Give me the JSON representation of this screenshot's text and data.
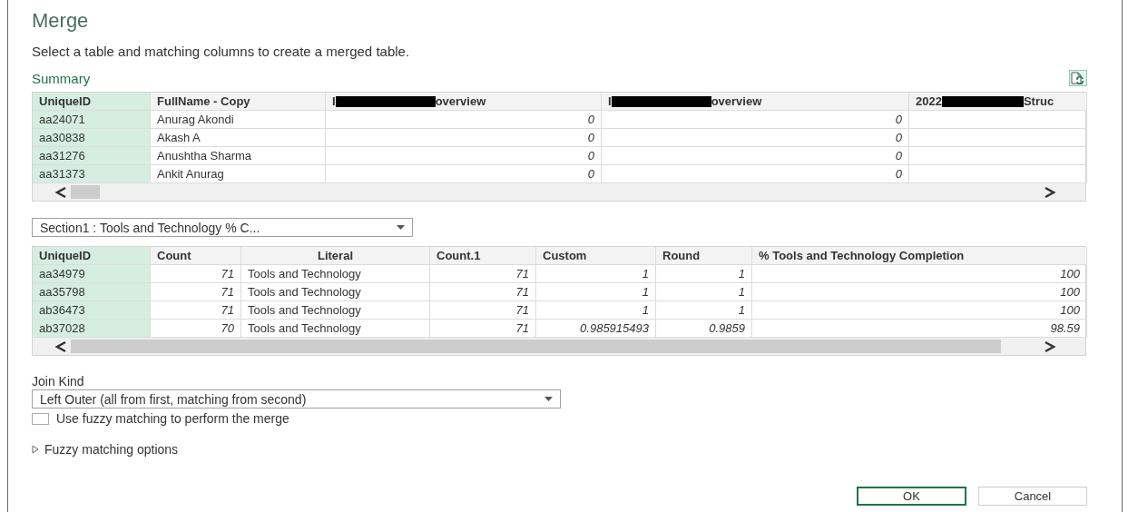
{
  "window": {
    "title": "Merge",
    "subtitle": "Select a table and matching columns to create a merged table."
  },
  "summary": {
    "label": "Summary"
  },
  "first_table": {
    "columns": [
      {
        "label": "UniqueID",
        "kind": "key"
      },
      {
        "label": "FullName - Copy",
        "kind": "text"
      },
      {
        "prefix": "I",
        "suffix": "overview",
        "redacted": true,
        "kind": "number"
      },
      {
        "prefix": "I",
        "suffix": "overview",
        "redacted": true,
        "kind": "number"
      },
      {
        "prefix": "2022",
        "suffix": "Struc",
        "redacted": true,
        "kind": "text"
      }
    ],
    "rows": [
      [
        "aa24071",
        "Anurag Akondi",
        "0",
        "0",
        ""
      ],
      [
        "aa30838",
        "Akash A",
        "0",
        "0",
        ""
      ],
      [
        "aa31276",
        "Anushtha Sharma",
        "0",
        "0",
        ""
      ],
      [
        "aa31373",
        "Ankit Anurag",
        "0",
        "0",
        ""
      ]
    ]
  },
  "second_table": {
    "selector": "Section1 : Tools and Technology % C...",
    "columns": [
      {
        "label": "UniqueID",
        "kind": "key"
      },
      {
        "label": "Count",
        "kind": "number"
      },
      {
        "label": "Literal",
        "kind": "text",
        "centered": true
      },
      {
        "label": "Count.1",
        "kind": "number"
      },
      {
        "label": "Custom",
        "kind": "number"
      },
      {
        "label": "Round",
        "kind": "number"
      },
      {
        "label": "% Tools and Technology Completion",
        "kind": "number"
      }
    ],
    "rows": [
      [
        "aa34979",
        "71",
        "Tools and Technology",
        "71",
        "1",
        "1",
        "100"
      ],
      [
        "aa35798",
        "71",
        "Tools and Technology",
        "71",
        "1",
        "1",
        "100"
      ],
      [
        "ab36473",
        "71",
        "Tools and Technology",
        "71",
        "1",
        "1",
        "100"
      ],
      [
        "ab37028",
        "70",
        "Tools and Technology",
        "71",
        "0.985915493",
        "0.9859",
        "98.59"
      ]
    ]
  },
  "join_kind": {
    "label": "Join Kind",
    "value": "Left Outer (all from first, matching from second)"
  },
  "fuzzy": {
    "label": "Use fuzzy matching to perform the merge",
    "checked": false
  },
  "fuzzy_options": {
    "label": "Fuzzy matching options",
    "expanded": false
  },
  "buttons": [
    {
      "label": "OK",
      "primary": true
    },
    {
      "label": "Cancel",
      "primary": false
    }
  ]
}
